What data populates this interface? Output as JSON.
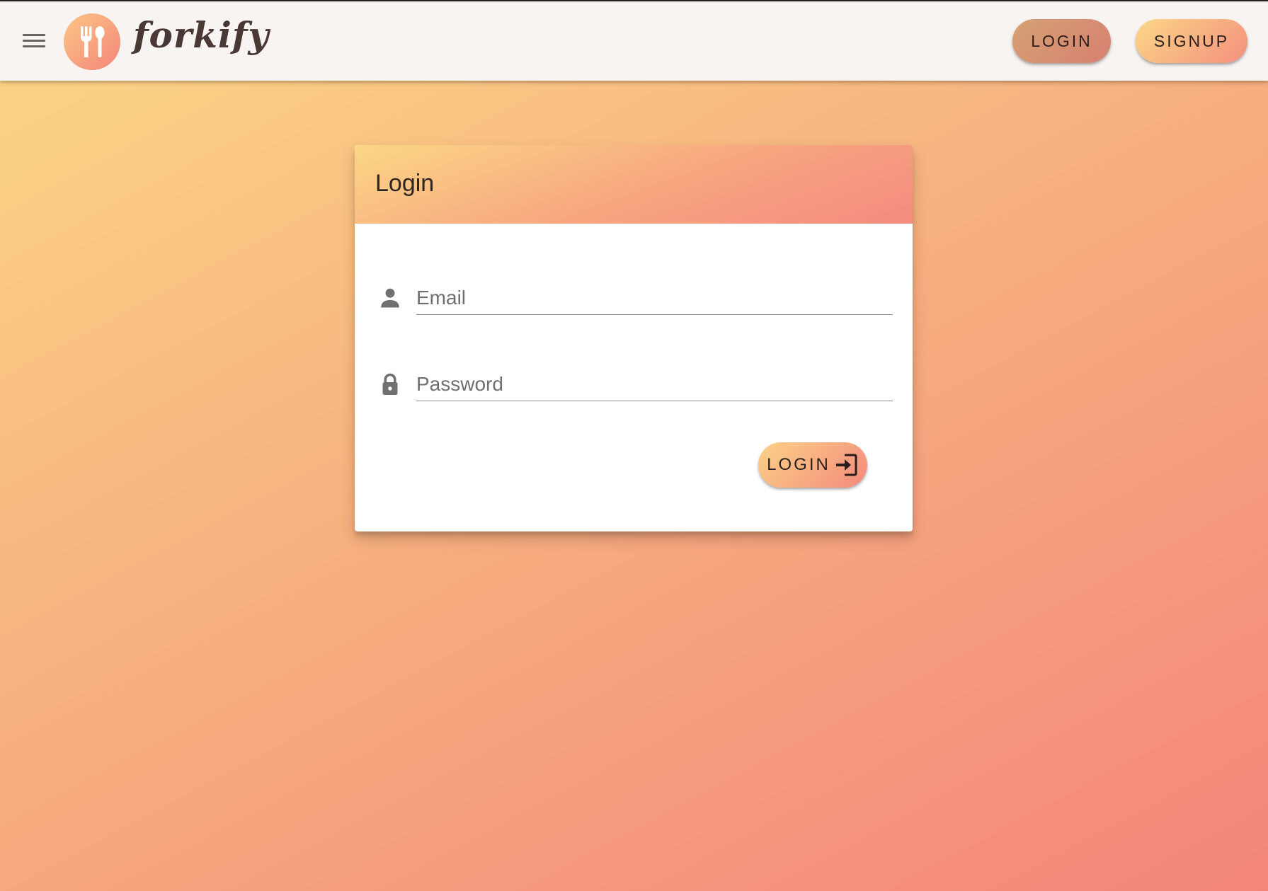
{
  "app": {
    "brand_name": "forkify",
    "colors": {
      "gradient_start": "#fbd786",
      "gradient_end": "#f4857b",
      "appbar_bg": "#f7f4f2",
      "card_bg": "#ffffff"
    }
  },
  "appbar": {
    "menu_icon": "hamburger-menu-icon",
    "logo_icon": "fork-spoon-icon",
    "login_label": "LOGIN",
    "signup_label": "SIGNUP"
  },
  "login_card": {
    "title": "Login",
    "email": {
      "icon": "person-icon",
      "placeholder": "Email",
      "value": ""
    },
    "password": {
      "icon": "lock-icon",
      "placeholder": "Password",
      "value": ""
    },
    "submit": {
      "label": "LOGIN",
      "icon": "login-icon"
    }
  }
}
